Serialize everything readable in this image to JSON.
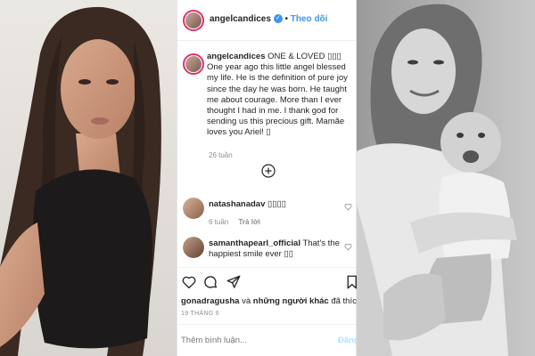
{
  "post": {
    "username": "angelcandices",
    "verified_symbol": "✓",
    "separator": "•",
    "follow_label": "Theo dõi"
  },
  "caption": {
    "username": "angelcandices",
    "text": "ONE & LOVED ▯▯▯ One year ago this little angel blessed my life. He is the definition of pure joy since the day he was born. He taught me about courage. More than I ever thought I had in me. I thank god for sending us this precious gift. Mamãe loves you Ariel! ▯",
    "time": "26 tuần"
  },
  "comments": [
    {
      "username": "natashanadav",
      "text": "▯▯▯▯",
      "time": "6 tuần",
      "reply_label": "Trả lời"
    },
    {
      "username": "samanthapearl_official",
      "text": "That's the happiest smile ever ▯▯"
    }
  ],
  "likes": {
    "first_user": "gonadragusha",
    "and_label": "và",
    "others_label": "những người khác",
    "liked_label": "đã thích"
  },
  "date": "19 THÁNG 6",
  "comment_box": {
    "placeholder": "Thêm bình luận...",
    "post_label": "Đăng"
  },
  "icons": [
    "heart-icon",
    "comment-icon",
    "share-icon",
    "bookmark-icon",
    "add-comments-icon",
    "verified-badge-icon"
  ],
  "colors": {
    "link": "#3897f0",
    "story_ring": "#e1306c",
    "text": "#262626",
    "muted": "#8e8e8e"
  }
}
